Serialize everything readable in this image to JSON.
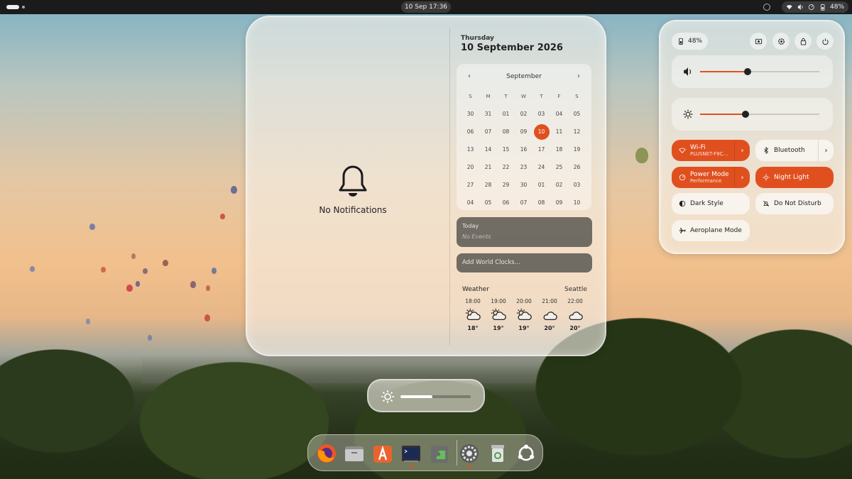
{
  "topbar": {
    "clock": "10 Sep  17:36",
    "battery": "48%"
  },
  "notifications": {
    "empty_label": "No Notifications"
  },
  "date": {
    "weekday": "Thursday",
    "full": "10 September 2026"
  },
  "calendar": {
    "month": "September",
    "prev": "‹",
    "next": "›",
    "weekdays": [
      "S",
      "M",
      "T",
      "W",
      "T",
      "F",
      "S"
    ],
    "weeks": [
      [
        "30",
        "31",
        "01",
        "02",
        "03",
        "04",
        "05"
      ],
      [
        "06",
        "07",
        "08",
        "09",
        "10",
        "11",
        "12"
      ],
      [
        "13",
        "14",
        "15",
        "16",
        "17",
        "18",
        "19"
      ],
      [
        "20",
        "21",
        "22",
        "23",
        "24",
        "25",
        "26"
      ],
      [
        "27",
        "28",
        "29",
        "30",
        "01",
        "02",
        "03"
      ],
      [
        "04",
        "05",
        "06",
        "07",
        "08",
        "09",
        "10"
      ]
    ],
    "today": "10"
  },
  "events": {
    "title": "Today",
    "empty": "No Events"
  },
  "world_clocks": {
    "label": "Add World Clocks…"
  },
  "weather": {
    "label": "Weather",
    "city": "Seattle",
    "forecast": [
      {
        "hour": "18:00",
        "icon": "partly-sunny-icon",
        "temp": "18°"
      },
      {
        "hour": "19:00",
        "icon": "partly-sunny-icon",
        "temp": "19°"
      },
      {
        "hour": "20:00",
        "icon": "partly-sunny-icon",
        "temp": "19°"
      },
      {
        "hour": "21:00",
        "icon": "cloudy-icon",
        "temp": "20°"
      },
      {
        "hour": "22:00",
        "icon": "cloudy-icon",
        "temp": "20°"
      }
    ]
  },
  "quick_settings": {
    "battery": "48%",
    "volume_level": 0.4,
    "brightness_level": 0.38,
    "toggles": {
      "wifi": {
        "label": "Wi-Fi",
        "sub": "PLUSNET-F9C…",
        "on": true
      },
      "bluetooth": {
        "label": "Bluetooth",
        "on": false
      },
      "power_mode": {
        "label": "Power Mode",
        "sub": "Performance",
        "on": true
      },
      "night_light": {
        "label": "Night Light",
        "on": true
      },
      "dark_style": {
        "label": "Dark Style",
        "on": false
      },
      "dnd": {
        "label": "Do Not Disturb",
        "on": false
      },
      "aeroplane": {
        "label": "Aeroplane Mode",
        "on": false
      }
    }
  },
  "osd": {
    "brightness_level": 0.45
  },
  "colors": {
    "accent": "#e0501f"
  },
  "dock": {
    "apps": [
      "firefox-icon",
      "files-icon",
      "app-center-icon",
      "terminal-icon",
      "extensions-icon",
      "settings-icon",
      "trash-icon",
      "ubuntu-apps-icon"
    ]
  }
}
